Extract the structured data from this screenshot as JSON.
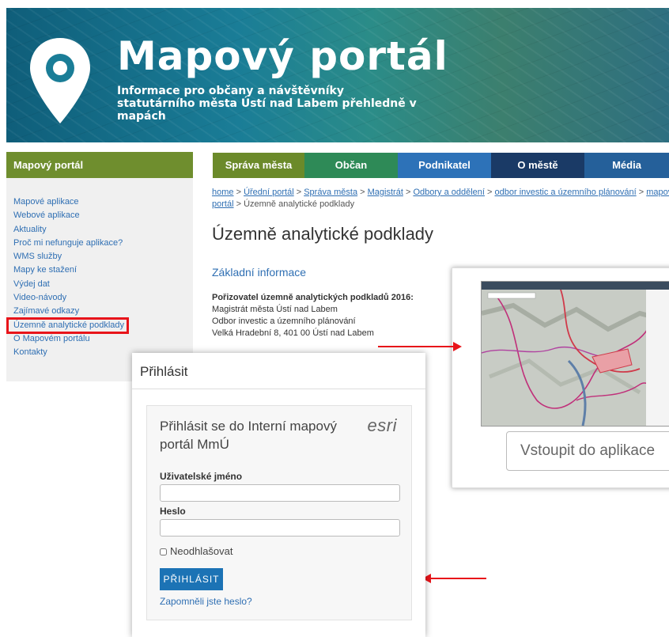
{
  "banner": {
    "title": "Mapový portál",
    "subtitle": "Informace pro občany a návštěvníky statutárního města Ústí nad Labem přehledně v mapách"
  },
  "sidebar": {
    "heading": "Mapový portál",
    "items": [
      {
        "label": "Mapové aplikace"
      },
      {
        "label": "Webové aplikace"
      },
      {
        "label": "Aktuality"
      },
      {
        "label": "Proč mi nefunguje aplikace?"
      },
      {
        "label": "WMS služby"
      },
      {
        "label": "Mapy ke stažení"
      },
      {
        "label": "Výdej dat"
      },
      {
        "label": "Video-návody"
      },
      {
        "label": "Zajímavé odkazy"
      },
      {
        "label": "Územně analytické podklady"
      },
      {
        "label": "O Mapovém portálu"
      },
      {
        "label": "Kontakty"
      }
    ]
  },
  "nav": {
    "tabs": [
      {
        "label": "Správa města"
      },
      {
        "label": "Občan"
      },
      {
        "label": "Podnikatel"
      },
      {
        "label": "O městě"
      },
      {
        "label": "Média"
      }
    ]
  },
  "breadcrumb": {
    "items": [
      "home",
      "Úřední portál",
      "Správa města",
      "Magistrát",
      "Odbory a oddělení",
      "odbor investic a územního plánování",
      "mapový",
      "portál"
    ],
    "current": "Územně analytické podklady",
    "sep": " > "
  },
  "page": {
    "title": "Územně analytické podklady",
    "section": "Základní informace",
    "info_heading": "Pořizovatel územně analytických podkladů 2016:",
    "info_lines": [
      "Magistrát města Ústí nad Labem",
      "Odbor investic a územního plánování",
      "Velká Hradební 8, 401 00 Ústí nad Labem"
    ]
  },
  "app_card": {
    "enter_label": "Vstoupit do aplikace"
  },
  "login": {
    "title": "Přihlásit",
    "heading": "Přihlásit se do Interní mapový portál MmÚ",
    "brand": "esri",
    "username_label": "Uživatelské jméno",
    "username_value": "",
    "password_label": "Heslo",
    "remember_label": "Neodhlašovat",
    "submit_label": "PŘIHLÁSIT",
    "forgot_label": "Zapomněli jste heslo?"
  },
  "colors": {
    "sidebar_head": "#6f8e2e",
    "link": "#2f6fb3",
    "highlight": "#e8141a",
    "submit": "#1c73b5"
  }
}
